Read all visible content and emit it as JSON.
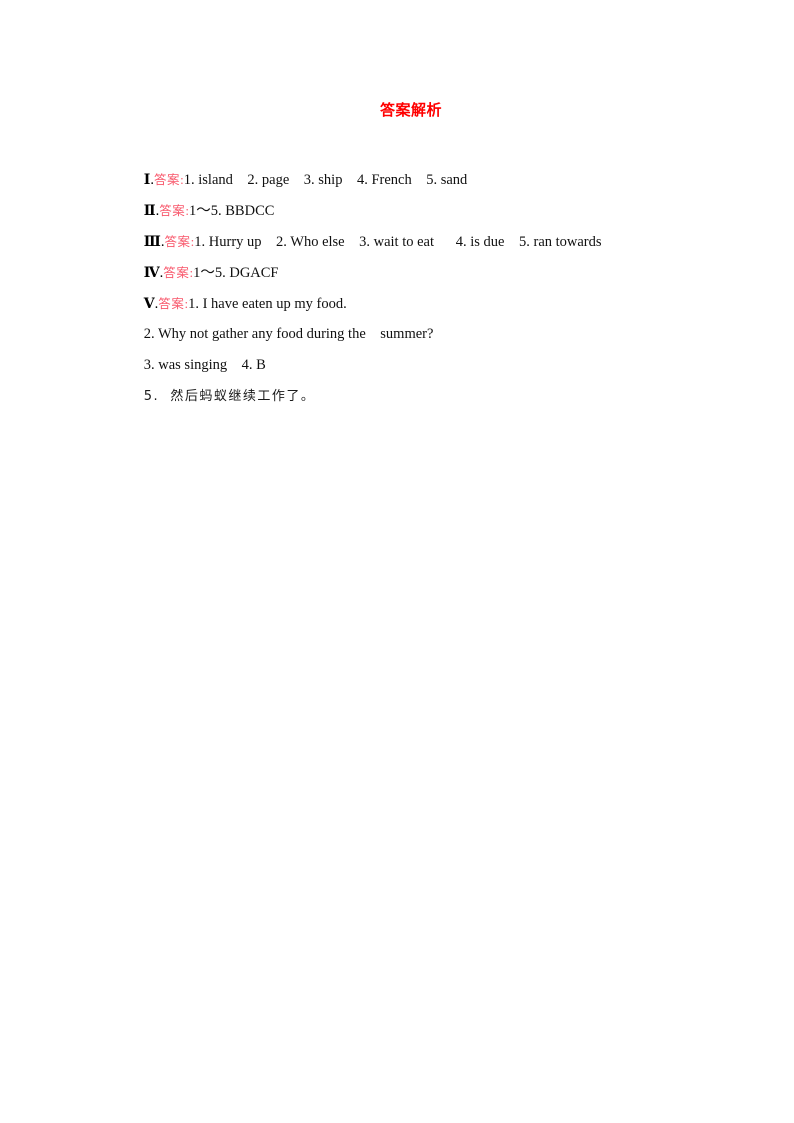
{
  "document": {
    "title": "答案解析",
    "title_color": "#ff0000",
    "label_color": "#f8566a",
    "body_color": "#101010",
    "page_background": "#ffffff"
  },
  "sections": [
    {
      "numeral": "Ⅰ",
      "separator": ".",
      "label": "答案",
      "colon": ":",
      "answers": "1. island    2. page    3. ship    4. French    5. sand"
    },
    {
      "numeral": "Ⅱ",
      "separator": ".",
      "label": "答案",
      "colon": ":",
      "answers": "1～5. BBDCC"
    },
    {
      "numeral": "Ⅲ",
      "separator": ".",
      "label": "答案",
      "colon": ":",
      "answers": "1. Hurry up    2. Who else    3. wait to eat      4. is due    5. ran towards"
    },
    {
      "numeral": "Ⅳ",
      "separator": ".",
      "label": "答案",
      "colon": ":",
      "answers": "1～5. DGACF"
    },
    {
      "numeral": "Ⅴ",
      "separator": ".",
      "label": "答案",
      "colon": ":",
      "answers": "1. I have eaten up my food."
    }
  ],
  "continuation_lines": [
    {
      "text": "2. Why not gather any food during the    summer?",
      "script": "latin"
    },
    {
      "text": "3. was singing    4. B",
      "script": "latin"
    },
    {
      "text": "5.  然后蚂蚁继续工作了。",
      "script": "mixed"
    }
  ]
}
